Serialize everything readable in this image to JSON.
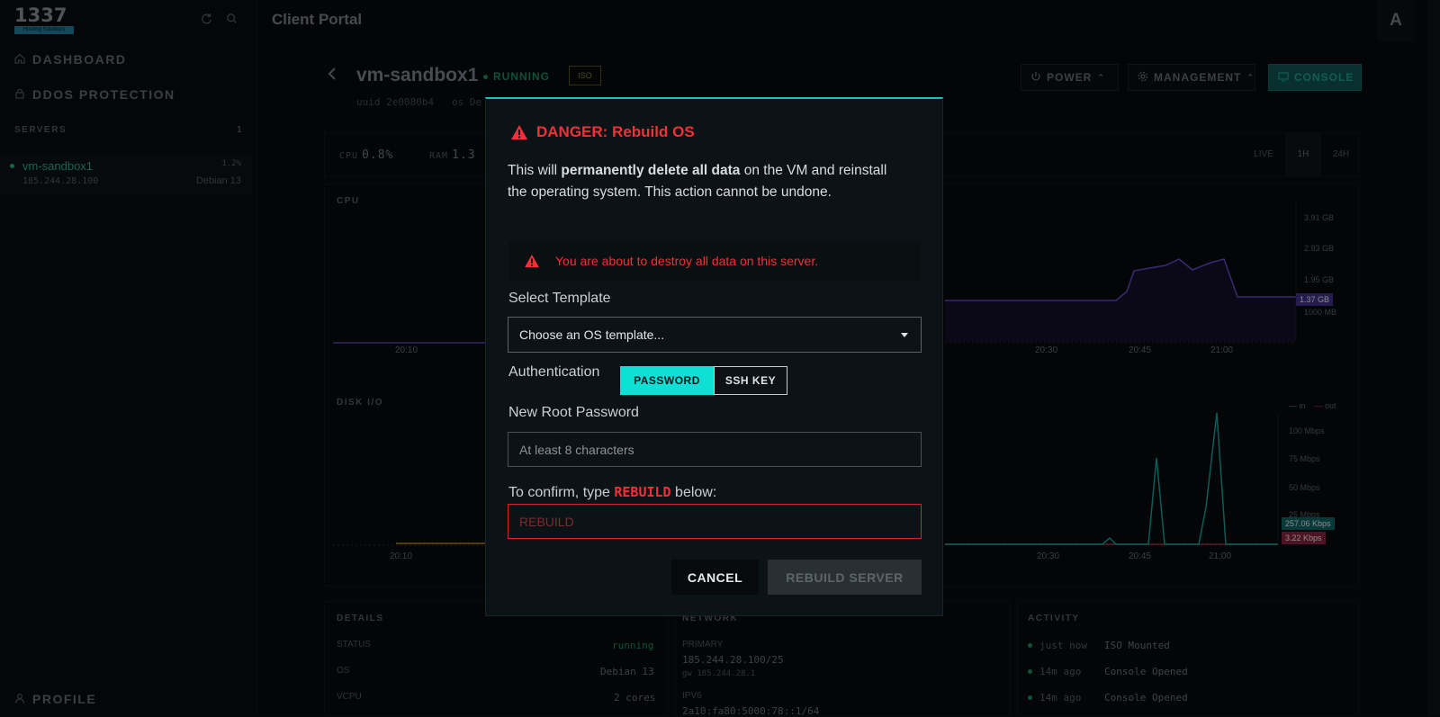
{
  "app": {
    "logo_text": "1337",
    "logo_sub": "Hosting Solutions",
    "portal_title": "Client Portal",
    "avatar_letter": "A"
  },
  "sidebar": {
    "nav": [
      {
        "label": "DASHBOARD",
        "icon": "home-icon"
      },
      {
        "label": "DDOS PROTECTION",
        "icon": "lock-icon"
      }
    ],
    "servers_heading": "SERVERS",
    "servers_count": "1",
    "server": {
      "name": "vm-sandbox1",
      "cpu": "1.2%",
      "ip": "185.244.28.100",
      "os": "Debian 13"
    },
    "profile_label": "PROFILE"
  },
  "vm": {
    "name": "vm-sandbox1",
    "status": "RUNNING",
    "iso_badge": "ISO",
    "uuid_label": "uuid",
    "uuid_value": "2e0080b4",
    "os_label": "os",
    "os_value": "De"
  },
  "header_buttons": {
    "power": "POWER",
    "management": "MANAGEMENT",
    "console": "CONSOLE"
  },
  "stats": {
    "cpu_label": "CPU",
    "cpu_value": "0.8%",
    "ram_label": "RAM",
    "ram_value": "1.3"
  },
  "ranges": {
    "live": "LIVE",
    "h1": "1H",
    "h24": "24H"
  },
  "charts": {
    "cpu_title": "CPU",
    "disk_title": "DISK I/O",
    "ram_ticks": [
      "3.91 GB",
      "2.93 GB",
      "1.95 GB",
      "1000 MB"
    ],
    "ram_current": "1.37 GB",
    "top_x_ticks": [
      "20:10",
      "20:30",
      "20:45",
      "21:00"
    ],
    "net_ticks": [
      "100 Mbps",
      "75 Mbps",
      "50 Mbps",
      "25 Mbps"
    ],
    "net_in_tag": "257.06 Kbps",
    "net_out_tag": "3.22 Kbps",
    "legend_in": "in",
    "legend_out": "out",
    "bottom_x_ticks": [
      "20:10",
      "20:30",
      "20:45",
      "21:00"
    ]
  },
  "details": {
    "title": "DETAILS",
    "status_label": "STATUS",
    "status_value": "running",
    "os_label": "OS",
    "os_value": "Debian 13",
    "vcpu_label": "VCPU",
    "vcpu_value": "2 cores"
  },
  "network": {
    "title": "NETWORK",
    "primary_label": "PRIMARY",
    "primary_ip": "185.244.28.100/25",
    "gateway": "gw 185.244.28.1",
    "ipv6_label": "IPV6",
    "ipv6_value": "2a10:fa80:5000:78::1/64"
  },
  "activity": {
    "title": "ACTIVITY",
    "items": [
      {
        "time": "just now",
        "text": "ISO Mounted"
      },
      {
        "time": "14m ago",
        "text": "Console Opened"
      },
      {
        "time": "14m ago",
        "text": "Console Opened"
      }
    ]
  },
  "modal": {
    "title": "DANGER: Rebuild OS",
    "intro_before": "This will ",
    "intro_bold": "permanently delete all data",
    "intro_after": " on the VM and reinstall the operating system. This action cannot be undone.",
    "alert_text": "You are about to destroy all data on this server.",
    "template_label": "Select Template",
    "template_value": "Choose an OS template...",
    "auth_label": "Authentication",
    "auth_password": "PASSWORD",
    "auth_ssh": "SSH KEY",
    "password_label": "New Root Password",
    "password_placeholder": "At least 8 characters",
    "confirm_before": "To confirm, type ",
    "confirm_keyword": "REBUILD",
    "confirm_after": " below:",
    "confirm_placeholder": "REBUILD",
    "cancel": "CANCEL",
    "rebuild": "REBUILD SERVER"
  },
  "colors": {
    "accent": "#0ee0d5",
    "danger": "#ef3236",
    "running": "#1f9a6c",
    "ram_line": "#5b3fb0",
    "net_in": "#13b4a8",
    "net_out": "#d33a5e"
  }
}
